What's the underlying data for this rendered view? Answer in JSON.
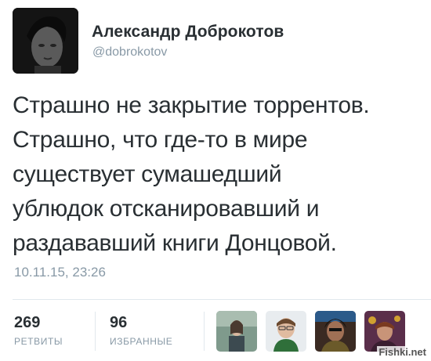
{
  "author": {
    "name": "Александр Доброкотов",
    "handle": "@dobrokotov"
  },
  "tweet": {
    "lines": [
      "Страшно не закрытие торрентов.",
      "Страшно, что где-то в мире",
      "существует сумашедший",
      "ублюдок отсканировавший и",
      "раздававший книги Донцовой."
    ],
    "timestamp": "10.11.15, 23:26"
  },
  "stats": {
    "retweets": {
      "count": "269",
      "label": "РЕТВИТЫ"
    },
    "favorites": {
      "count": "96",
      "label": "ИЗБРАННЫЕ"
    }
  },
  "favoriters": [
    {
      "icon": "user-avatar-icon"
    },
    {
      "icon": "user-avatar-icon"
    },
    {
      "icon": "user-avatar-icon"
    },
    {
      "icon": "user-avatar-icon"
    }
  ],
  "watermark": "Fishki.net",
  "colors": {
    "text": "#292f33",
    "muted": "#8899a6",
    "divider": "#e1e8ed"
  }
}
